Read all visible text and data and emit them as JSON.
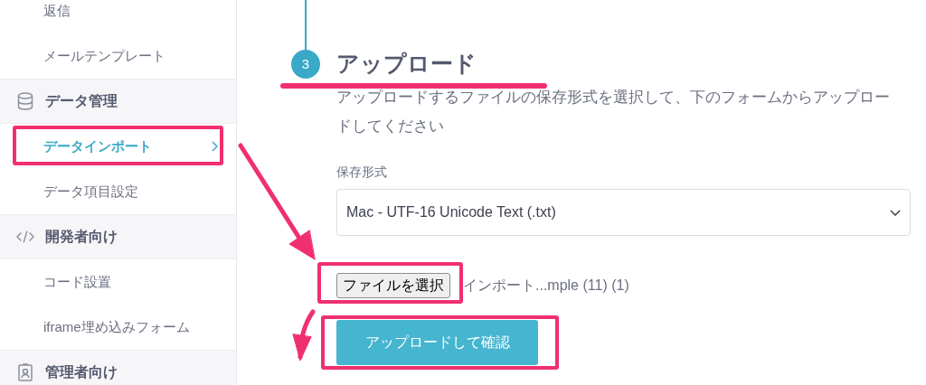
{
  "sidebar": {
    "items": [
      {
        "kind": "item",
        "label": "返信",
        "selected": false,
        "highlighted": false
      },
      {
        "kind": "item",
        "label": "メールテンプレート",
        "selected": false,
        "highlighted": false
      },
      {
        "kind": "section",
        "label": "データ管理"
      },
      {
        "kind": "item",
        "label": "データインポート",
        "selected": true,
        "highlighted": true
      },
      {
        "kind": "item",
        "label": "データ項目設定",
        "selected": false,
        "highlighted": false
      },
      {
        "kind": "section",
        "label": "開発者向け"
      },
      {
        "kind": "item",
        "label": "コード設置",
        "selected": false,
        "highlighted": false
      },
      {
        "kind": "item",
        "label": "iframe埋め込みフォーム",
        "selected": false,
        "highlighted": false
      },
      {
        "kind": "section",
        "label": "管理者向け"
      }
    ]
  },
  "step": {
    "number": "3",
    "title": "アップロード",
    "underlined": true,
    "description": "アップロードするファイルの保存形式を選択して、下のフォームからアップロードしてください"
  },
  "form": {
    "format_label": "保存形式",
    "format_value": "Mac - UTF-16 Unicode Text (.txt)",
    "file_button": {
      "label": "ファイルを選択",
      "highlighted": true
    },
    "file_name": "インポート...mple (11) (1)",
    "submit_button": {
      "label": "アップロードして確認",
      "highlighted": true
    }
  }
}
